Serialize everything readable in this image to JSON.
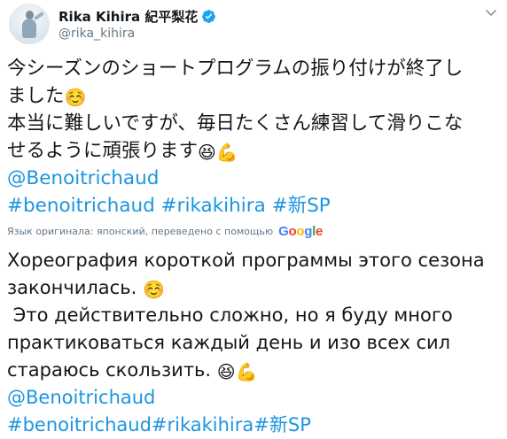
{
  "user": {
    "display_name": "Rika Kihira 紀平梨花",
    "handle": "@rika_kihira"
  },
  "original": {
    "line1": "今シーズンのショートプログラムの振り付けが終了し",
    "line2": "ました",
    "line3": "本当に難しいですが、毎日たくさん練習して滑りこな",
    "line4": "せるように頑張ります",
    "mention": "@Benoitrichaud",
    "hashtag1": "#benoitrichaud",
    "hashtag2": "#rikakihira",
    "hashtag3": "#新SP"
  },
  "translation": {
    "note": "Язык оригинала: японский, переведено с помощью",
    "provider": "Google",
    "line1": "Хореография короткой программы этого сезона",
    "line2": "закончилась.",
    "line3": " Это действительно сложно, но я буду много",
    "line4": "практиковаться каждый день и изо всех сил",
    "line5": "стараюсь скользить.",
    "mention": "@Benoitrichaud",
    "hashtags": "#benoitrichaud#rikakihira#新SP"
  },
  "icons": {
    "verified": "verified-badge-icon",
    "menu": "chevron-down-icon",
    "emoji_smile": "smiling-face-emoji",
    "emoji_laugh": "grinning-squinting-face-emoji",
    "emoji_muscle": "flexed-biceps-emoji"
  },
  "colors": {
    "link": "#1b95e0",
    "text": "#14171a",
    "secondary": "#657786",
    "verified": "#1da1f2"
  }
}
